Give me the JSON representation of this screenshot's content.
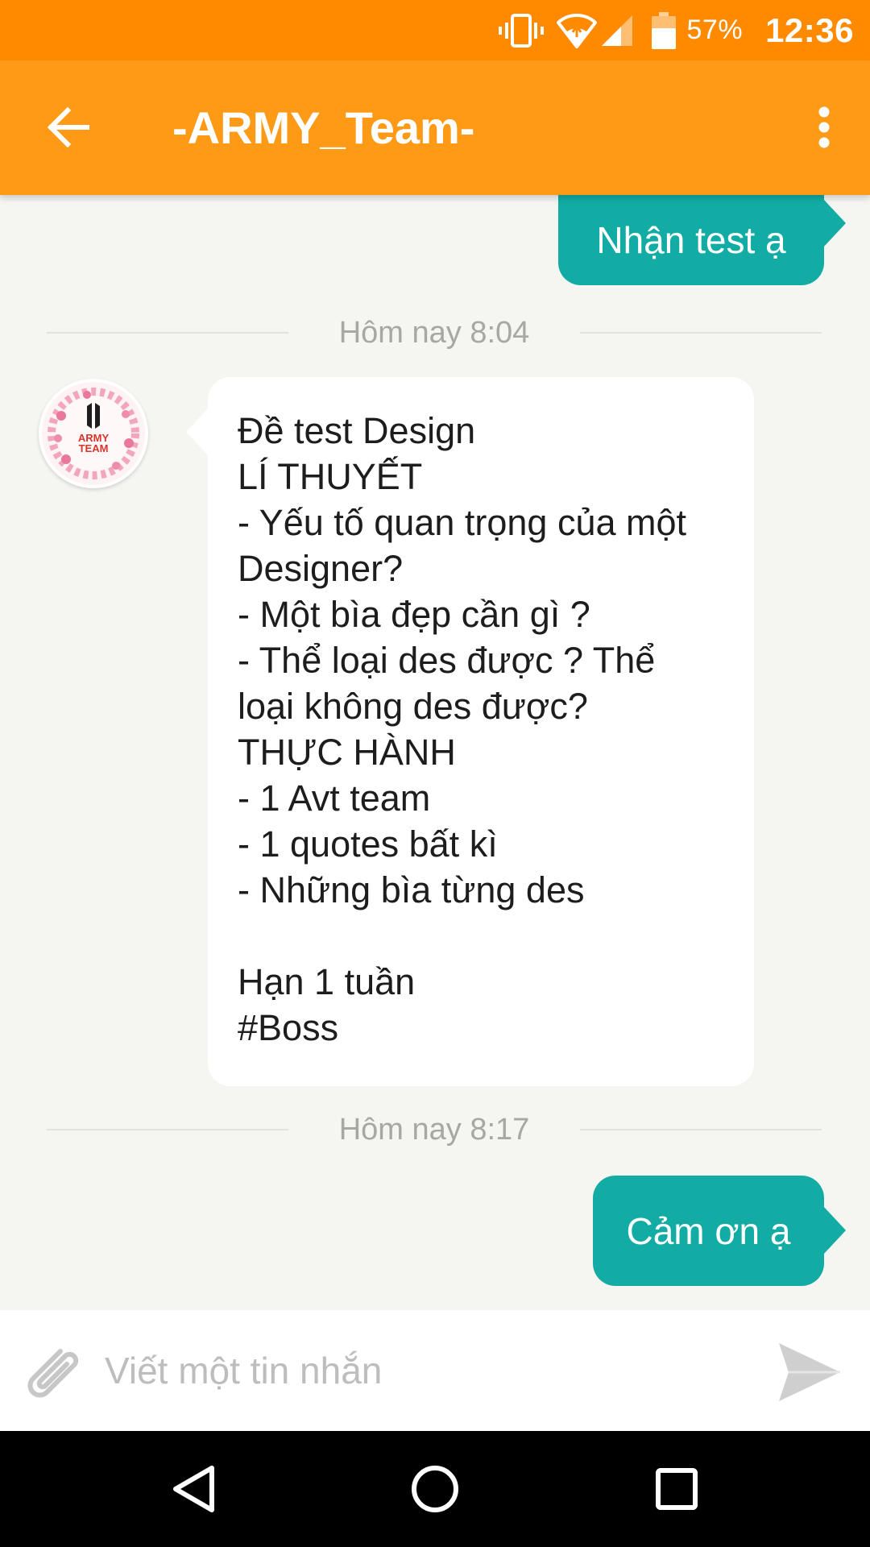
{
  "status_bar": {
    "battery_percent": "57%",
    "time": "12:36",
    "icons": [
      "vibrate-icon",
      "wifi-icon",
      "cell-signal-icon",
      "battery-icon"
    ]
  },
  "app_bar": {
    "title": "-ARMY_Team-",
    "back_icon": "arrow-left-icon",
    "menu_icon": "more-vert-icon"
  },
  "messages": [
    {
      "direction": "outgoing",
      "text": "Nhận test ạ"
    },
    {
      "type": "timestamp",
      "text": "Hôm nay 8:04"
    },
    {
      "direction": "incoming",
      "sender_avatar": "army-team-logo",
      "lines": [
        "Đề test Design",
        "LÍ THUYẾT",
        "- Yếu tố quan trọng của một",
        "Designer?",
        "- Một bìa đẹp cần gì ?",
        "- Thể loại des được ? Thể",
        "loại không des được?",
        "THỰC HÀNH",
        "- 1 Avt team",
        "- 1 quotes bất kì",
        "- Những bìa từng des",
        "",
        "Hạn 1 tuần",
        "#Boss"
      ]
    },
    {
      "type": "timestamp",
      "text": "Hôm nay 8:17"
    },
    {
      "direction": "outgoing",
      "text": "Cảm ơn ạ"
    }
  ],
  "composer": {
    "placeholder": "Viết một tin nhắn",
    "value": "",
    "attach_icon": "paperclip-icon",
    "send_icon": "send-icon"
  },
  "avatar_logo_text": [
    "ARMY",
    "TEAM"
  ],
  "nav_bar": {
    "icons": [
      "back-triangle-icon",
      "home-circle-icon",
      "recents-square-icon"
    ]
  },
  "colors": {
    "status_bar": "#ff8a00",
    "app_bar": "#ff9a17",
    "outgoing_bubble": "#12aca4",
    "incoming_bubble": "#ffffff",
    "chat_background": "#f5f5f2",
    "timestamp_text": "#a7a7a3"
  }
}
